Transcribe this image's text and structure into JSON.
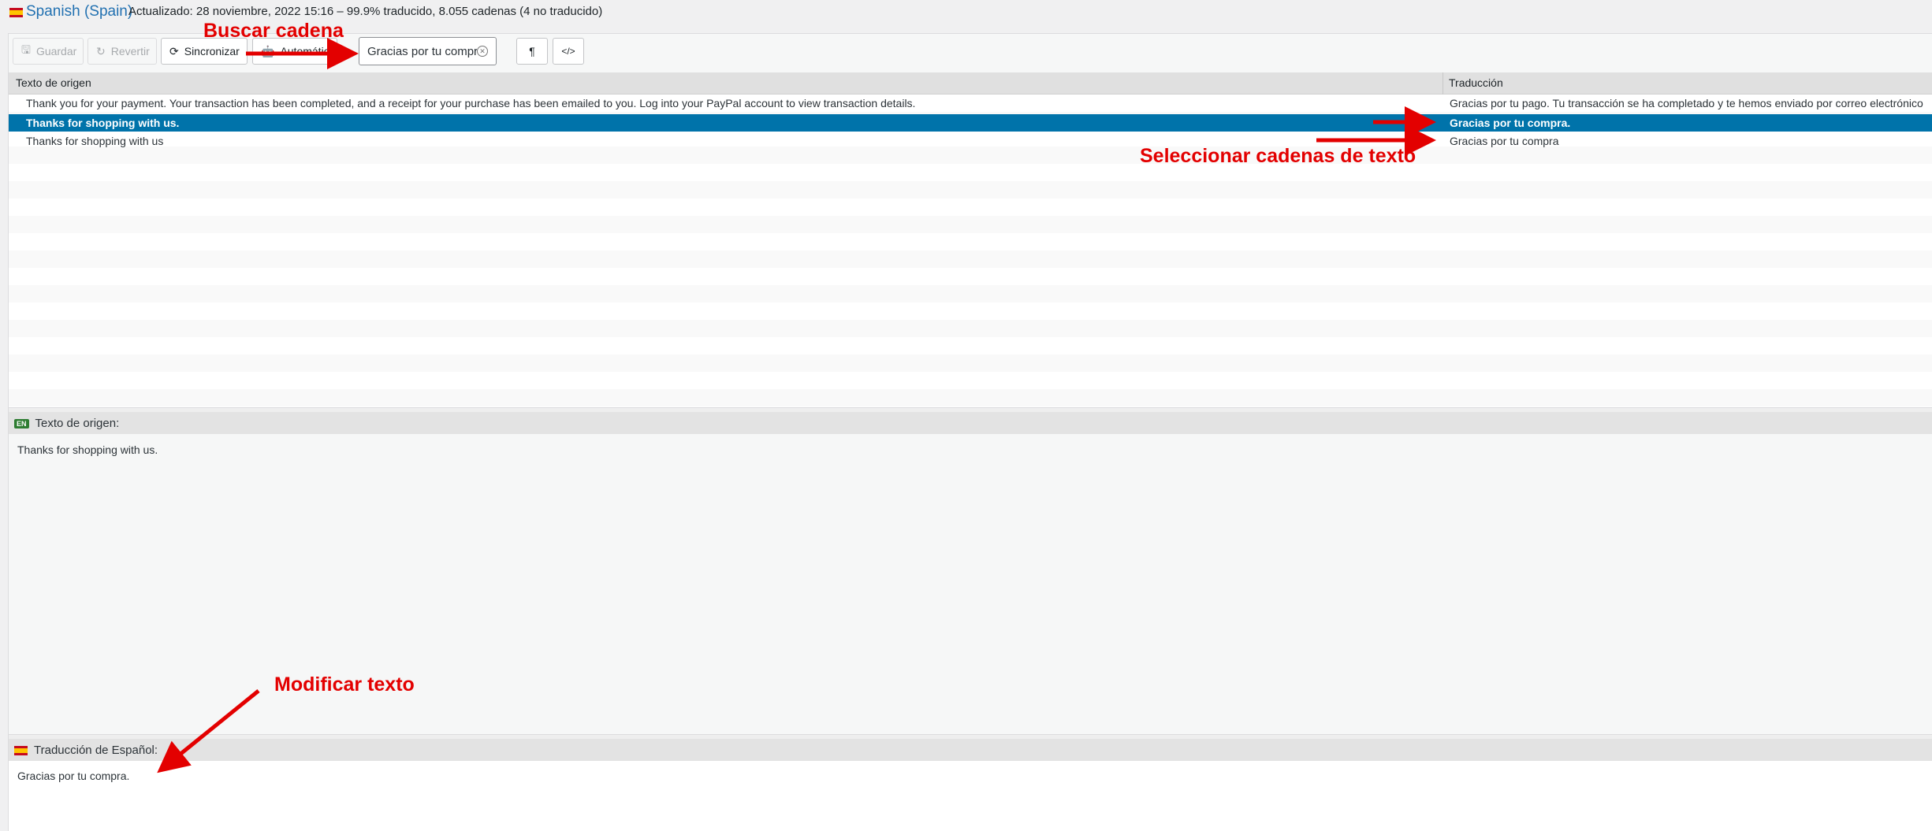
{
  "header": {
    "language_name": "Spanish (Spain)",
    "status": "Actualizado: 28 noviembre, 2022 15:16 – 99.9% traducido, 8.055 cadenas (4 no traducido)"
  },
  "toolbar": {
    "save_label": "Guardar",
    "revert_label": "Revertir",
    "sync_label": "Sincronizar",
    "auto_label": "Automática",
    "search_value": "Gracias por tu compra",
    "pilcrow_label": "¶",
    "code_label": "</>"
  },
  "list": {
    "col_source": "Texto de origen",
    "col_translation": "Traducción",
    "rows": [
      {
        "source": "Thank you for your payment. Your transaction has been completed, and a receipt for your purchase has been emailed to you. Log into your PayPal account to view transaction details.",
        "translation": "Gracias por tu pago. Tu transacción se ha completado y te hemos enviado por correo electrónico"
      },
      {
        "source": "Thanks for shopping with us.",
        "translation": "Gracias por tu compra."
      },
      {
        "source": "Thanks for shopping with us",
        "translation": "Gracias por tu compra"
      }
    ]
  },
  "source_pane": {
    "flag": "EN",
    "title": "Texto de origen:",
    "text": "Thanks for shopping with us."
  },
  "translation_pane": {
    "title": "Traducción de Español:",
    "text": "Gracias por tu compra."
  },
  "annotations": {
    "search": "Buscar cadena",
    "select": "Seleccionar cadenas de texto",
    "modify": "Modificar texto",
    "color": "#e30000"
  },
  "colors": {
    "selected_row": "#0073aa",
    "link": "#2271b1"
  }
}
